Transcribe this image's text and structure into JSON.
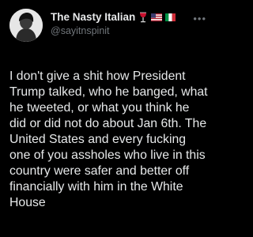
{
  "author": {
    "display_name": "The Nasty Italian",
    "handle": "@sayitnspinit",
    "name_emojis": [
      "wine-glass-icon",
      "us-flag-icon",
      "italy-flag-icon"
    ]
  },
  "tweet": {
    "text": "I don't give a shit how President Trump talked, who he banged, what he tweeted, or what you think he did or did not do about Jan 6th. The United States and every fucking one of you assholes who live in this country were safer and better off financially with him in the White House"
  },
  "colors": {
    "background": "#000000",
    "primary_text": "#e7e9ea",
    "secondary_text": "#71767b"
  },
  "icons": {
    "more": "more-options-icon",
    "avatar": "avatar"
  }
}
